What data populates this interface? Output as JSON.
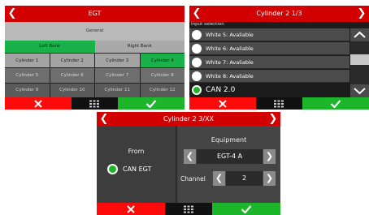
{
  "screen1": {
    "title": "EGT",
    "section": "General",
    "banks": [
      "Left Bank",
      "Right Bank"
    ],
    "cylinders": [
      [
        "Cylinder 1",
        "Cylinder 2",
        "Cylinder 3",
        "Cylinder 4"
      ],
      [
        "Cylinder 5",
        "Cylinder 6",
        "Cylinder 7",
        "Cylinder 8"
      ],
      [
        "Cylinder 9",
        "Cylinder 10",
        "Cylinder 11",
        "Cylinder 12"
      ]
    ],
    "selected_cylinder": "Cylinder 4"
  },
  "screen2": {
    "title": "Cylinder 2 1/3",
    "caption": "Input selection",
    "items": [
      "White 5: Avaliable",
      "White 6: Avaliable",
      "White 7: Avaliable",
      "White 8: Avaliable",
      "CAN 2.0"
    ],
    "selected_item": "CAN 2.0"
  },
  "screen3": {
    "title": "Cylinder 2 3/XX",
    "from_label": "From",
    "from_value": "CAN EGT",
    "equipment_label": "Equipment",
    "equipment_value": "EGT-4 A",
    "channel_label": "Channel",
    "channel_value": "2"
  },
  "icons": {
    "nav_prev": "chevron-left-icon",
    "nav_next": "chevron-right-icon",
    "cancel": "x-icon",
    "menu": "grid-menu-icon",
    "confirm": "check-icon",
    "scroll_up": "chevron-up-icon",
    "scroll_down": "chevron-down-icon"
  },
  "colors": {
    "title_red": "#d20000",
    "cancel_red": "#ff0a0a",
    "confirm_green": "#1db52a",
    "selected_green": "#19b14a"
  }
}
